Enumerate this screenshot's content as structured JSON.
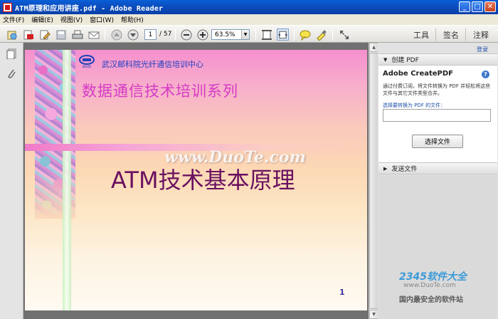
{
  "window": {
    "title": "ATM原理和应用讲座.pdf - Adobe Reader",
    "buttons": {
      "minimize": "_",
      "maximize": "□",
      "close": "✕"
    }
  },
  "menu": [
    "文件(F)",
    "编辑(E)",
    "视图(V)",
    "窗口(W)",
    "帮助(H)"
  ],
  "toolbar": {
    "page_current": "1",
    "page_total": "/ 57",
    "zoom": "63.5%",
    "tabs": [
      "工具",
      "签名",
      "注释"
    ]
  },
  "slide": {
    "org": "武汉邮科院光纤通信培训中心",
    "series": "数据通信技术培训系列",
    "watermark": "www.DuoTe.com",
    "title": "ATM技术基本原理",
    "page_number": "1",
    "logo_text": "邮科院"
  },
  "panel": {
    "login": "登录",
    "create_pdf_header": "创建 PDF",
    "product": "Adobe CreatePDF",
    "help": "?",
    "description": "通过付费订阅，将文件转换为 PDF 并轻松将这些文件与其它文件类型合并。",
    "file_label": "选择要转换为 PDF 的文件：",
    "choose_button": "选择文件",
    "send_files_header": "发送文件"
  },
  "watermark_brand": {
    "name": "2345软件大全",
    "url": "www.DuoTe.com",
    "slogan": "国内最安全的软件站"
  }
}
